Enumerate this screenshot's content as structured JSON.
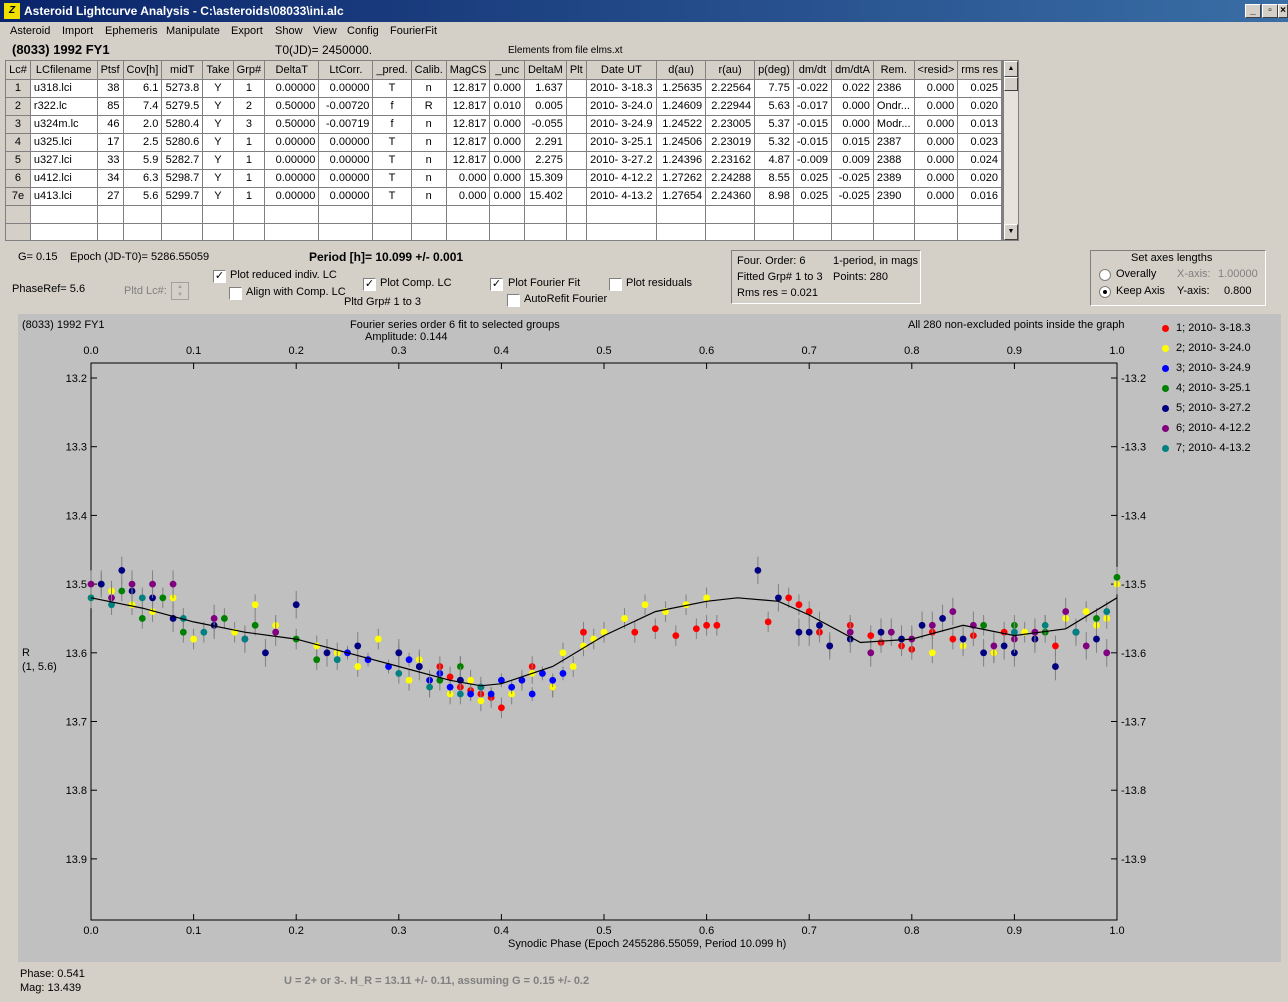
{
  "window": {
    "title": "Asteroid Lightcurve Analysis - C:\\asteroids\\08033\\ini.alc",
    "icon": "app-icon"
  },
  "menu": [
    "Asteroid",
    "Import",
    "Ephemeris",
    "Manipulate",
    "Export",
    "Show",
    "View",
    "Config",
    "FourierFit"
  ],
  "header": {
    "object": "(8033) 1992 FY1",
    "t0": "T0(JD)= 2450000.",
    "elements": "Elements from file elms.xt"
  },
  "grid": {
    "columns": [
      "Lc#",
      "LCfilename",
      "Ptsf",
      "Cov[h]",
      "midT",
      "Take",
      "Grp#",
      "DeltaT",
      "LtCorr.",
      "_pred.",
      "Calib.",
      "MagCS",
      "_unc",
      "DeltaM",
      "Plt",
      "Date UT",
      "d(au)",
      "r(au)",
      "p(deg)",
      "dm/dt",
      "dm/dtA",
      "Rem.",
      "<resid>",
      "rms res"
    ],
    "rows": [
      [
        "1",
        "u318.lci",
        "38",
        "6.1",
        "5273.8",
        "Y",
        "1",
        "0.00000",
        "0.00000",
        "T",
        "n",
        "12.817",
        "0.000",
        "1.637",
        "",
        "2010- 3-18.3",
        "1.25635",
        "2.22564",
        "7.75",
        "-0.022",
        "0.022",
        "2386",
        "0.000",
        "0.025"
      ],
      [
        "2",
        "r322.lc",
        "85",
        "7.4",
        "5279.5",
        "Y",
        "2",
        "0.50000",
        "-0.00720",
        "f",
        "R",
        "12.817",
        "0.010",
        "0.005",
        "",
        "2010- 3-24.0",
        "1.24609",
        "2.22944",
        "5.63",
        "-0.017",
        "0.000",
        "Ondr...",
        "0.000",
        "0.020"
      ],
      [
        "3",
        "u324m.lc",
        "46",
        "2.0",
        "5280.4",
        "Y",
        "3",
        "0.50000",
        "-0.00719",
        "f",
        "n",
        "12.817",
        "0.000",
        "-0.055",
        "",
        "2010- 3-24.9",
        "1.24522",
        "2.23005",
        "5.37",
        "-0.015",
        "0.000",
        "Modr...",
        "0.000",
        "0.013"
      ],
      [
        "4",
        "u325.lci",
        "17",
        "2.5",
        "5280.6",
        "Y",
        "1",
        "0.00000",
        "0.00000",
        "T",
        "n",
        "12.817",
        "0.000",
        "2.291",
        "",
        "2010- 3-25.1",
        "1.24506",
        "2.23019",
        "5.32",
        "-0.015",
        "0.015",
        "2387",
        "0.000",
        "0.023"
      ],
      [
        "5",
        "u327.lci",
        "33",
        "5.9",
        "5282.7",
        "Y",
        "1",
        "0.00000",
        "0.00000",
        "T",
        "n",
        "12.817",
        "0.000",
        "2.275",
        "",
        "2010- 3-27.2",
        "1.24396",
        "2.23162",
        "4.87",
        "-0.009",
        "0.009",
        "2388",
        "0.000",
        "0.024"
      ],
      [
        "6",
        "u412.lci",
        "34",
        "6.3",
        "5298.7",
        "Y",
        "1",
        "0.00000",
        "0.00000",
        "T",
        "n",
        "0.000",
        "0.000",
        "15.309",
        "",
        "2010- 4-12.2",
        "1.27262",
        "2.24288",
        "8.55",
        "0.025",
        "-0.025",
        "2389",
        "0.000",
        "0.020"
      ],
      [
        "7e",
        "u413.lci",
        "27",
        "5.6",
        "5299.7",
        "Y",
        "1",
        "0.00000",
        "0.00000",
        "T",
        "n",
        "0.000",
        "0.000",
        "15.402",
        "",
        "2010- 4-13.2",
        "1.27654",
        "2.24360",
        "8.98",
        "0.025",
        "-0.025",
        "2390",
        "0.000",
        "0.016"
      ]
    ]
  },
  "controls": {
    "g": "G= 0.15",
    "epoch": "Epoch (JD-T0)= 5286.55059",
    "period": "Period [h]= 10.099 +/- 0.001",
    "phaseref": "PhaseRef= 5.6",
    "pltd_lc": "Pltd Lc#:",
    "plot_reduced": "Plot reduced indiv. LC",
    "align_comp": "Align with Comp. LC",
    "plot_comp": "Plot Comp. LC",
    "pltd_grp": "Pltd Grp#  1   to   3",
    "plot_fourier": "Plot Fourier Fit",
    "autorefit": "AutoRefit Fourier",
    "plot_residuals": "Plot residuals",
    "four_order": "Four. Order:  6",
    "one_period": "1-period, in mags",
    "fitted_grp": "Fitted Grp# 1 to 3",
    "points": "Points: 280",
    "rms": "Rms res     = 0.021",
    "axes_title": "Set axes lengths",
    "overally": "Overally",
    "keep_axis": "Keep Axis",
    "xaxis_lbl": "X-axis:",
    "xaxis_val": "1.00000",
    "yaxis_lbl": "Y-axis:",
    "yaxis_val": "0.800"
  },
  "chart_texts": {
    "top_left": "(8033) 1992 FY1",
    "fit_title": "Fourier series order 6 fit to selected groups",
    "amplitude": "Amplitude: 0.144",
    "points_note": "All 280 non-excluded points inside the graph",
    "ylabel": "R",
    "ylabel2": "(1, 5.6)"
  },
  "chart_data": {
    "type": "scatter",
    "xlabel": "Synodic Phase (Epoch 2455286.55059, Period 10.099 h)",
    "ylabel": "R",
    "xlim": [
      0,
      1
    ],
    "ylim": [
      13.2,
      13.9
    ],
    "y_inverted": true,
    "xticks": [
      "0.0",
      "0.1",
      "0.2",
      "0.3",
      "0.4",
      "0.5",
      "0.6",
      "0.7",
      "0.8",
      "0.9",
      "1.0"
    ],
    "yticks": [
      "13.2",
      "13.3",
      "13.4",
      "13.5",
      "13.6",
      "13.7",
      "13.8",
      "13.9"
    ],
    "fourier_curve": {
      "x": [
        0,
        0.05,
        0.1,
        0.15,
        0.2,
        0.25,
        0.3,
        0.35,
        0.38,
        0.4,
        0.45,
        0.5,
        0.55,
        0.6,
        0.63,
        0.67,
        0.7,
        0.75,
        0.8,
        0.85,
        0.9,
        0.95,
        1.0
      ],
      "y": [
        13.52,
        13.535,
        13.555,
        13.57,
        13.58,
        13.6,
        13.62,
        13.64,
        13.648,
        13.645,
        13.62,
        13.575,
        13.54,
        13.525,
        13.52,
        13.525,
        13.545,
        13.585,
        13.58,
        13.56,
        13.575,
        13.565,
        13.52
      ]
    },
    "series": [
      {
        "name": "1; 2010- 3-18.3",
        "color": "#ff0000",
        "x": [
          0.33,
          0.34,
          0.35,
          0.36,
          0.37,
          0.38,
          0.39,
          0.4,
          0.43,
          0.45,
          0.48,
          0.53,
          0.55,
          0.57,
          0.59,
          0.6,
          0.61,
          0.66,
          0.68,
          0.69,
          0.7,
          0.71,
          0.72,
          0.74,
          0.76,
          0.77,
          0.79,
          0.8,
          0.82,
          0.84,
          0.86,
          0.88,
          0.89,
          0.92,
          0.94
        ],
        "y": [
          13.64,
          13.62,
          13.635,
          13.65,
          13.655,
          13.66,
          13.665,
          13.68,
          13.62,
          13.65,
          13.57,
          13.57,
          13.565,
          13.575,
          13.565,
          13.56,
          13.56,
          13.555,
          13.52,
          13.53,
          13.54,
          13.57,
          13.59,
          13.56,
          13.575,
          13.585,
          13.59,
          13.595,
          13.57,
          13.58,
          13.575,
          13.6,
          13.57,
          13.58,
          13.59
        ],
        "yerr": 0.015
      },
      {
        "name": "2; 2010- 3-24.0",
        "color": "#ffff00",
        "x": [
          0.0,
          0.02,
          0.04,
          0.06,
          0.08,
          0.1,
          0.12,
          0.14,
          0.16,
          0.18,
          0.22,
          0.24,
          0.26,
          0.28,
          0.3,
          0.31,
          0.32,
          0.33,
          0.34,
          0.35,
          0.36,
          0.37,
          0.38,
          0.41,
          0.42,
          0.43,
          0.45,
          0.46,
          0.47,
          0.48,
          0.49,
          0.5,
          0.52,
          0.54,
          0.56,
          0.58,
          0.6,
          0.8,
          0.82,
          0.85,
          0.88,
          0.9,
          0.91,
          0.93,
          0.95,
          0.97,
          0.98,
          0.99,
          1.0
        ],
        "y": [
          13.52,
          13.51,
          13.53,
          13.54,
          13.52,
          13.58,
          13.56,
          13.57,
          13.53,
          13.56,
          13.59,
          13.6,
          13.62,
          13.58,
          13.6,
          13.64,
          13.61,
          13.65,
          13.63,
          13.66,
          13.62,
          13.64,
          13.67,
          13.66,
          13.64,
          13.63,
          13.65,
          13.6,
          13.62,
          13.59,
          13.58,
          13.57,
          13.55,
          13.53,
          13.54,
          13.53,
          13.52,
          13.58,
          13.6,
          13.59,
          13.6,
          13.58,
          13.57,
          13.56,
          13.55,
          13.54,
          13.56,
          13.55,
          13.5
        ],
        "yerr": 0.015
      },
      {
        "name": "3; 2010- 3-24.9",
        "color": "#0000ff",
        "x": [
          0.25,
          0.27,
          0.29,
          0.3,
          0.31,
          0.32,
          0.33,
          0.34,
          0.35,
          0.36,
          0.37,
          0.38,
          0.39,
          0.4,
          0.41,
          0.42,
          0.43,
          0.44,
          0.45,
          0.46
        ],
        "y": [
          13.6,
          13.61,
          13.62,
          13.6,
          13.61,
          13.62,
          13.64,
          13.63,
          13.65,
          13.64,
          13.66,
          13.65,
          13.66,
          13.64,
          13.65,
          13.64,
          13.66,
          13.63,
          13.64,
          13.63
        ],
        "yerr": 0.01
      },
      {
        "name": "4; 2010- 3-25.1",
        "color": "#008000",
        "x": [
          0.01,
          0.03,
          0.05,
          0.07,
          0.09,
          0.13,
          0.16,
          0.2,
          0.22,
          0.34,
          0.36,
          0.87,
          0.9,
          0.93,
          0.96,
          0.98,
          1.0
        ],
        "y": [
          13.5,
          13.51,
          13.55,
          13.52,
          13.57,
          13.55,
          13.56,
          13.58,
          13.61,
          13.64,
          13.62,
          13.56,
          13.56,
          13.57,
          13.57,
          13.55,
          13.49
        ],
        "yerr": 0.015
      },
      {
        "name": "5; 2010- 3-27.2",
        "color": "#000080",
        "x": [
          0.01,
          0.03,
          0.04,
          0.06,
          0.08,
          0.12,
          0.17,
          0.2,
          0.23,
          0.26,
          0.3,
          0.32,
          0.36,
          0.65,
          0.67,
          0.69,
          0.7,
          0.71,
          0.72,
          0.74,
          0.77,
          0.79,
          0.81,
          0.83,
          0.85,
          0.87,
          0.89,
          0.9,
          0.92,
          0.94,
          0.96,
          0.98
        ],
        "y": [
          13.5,
          13.48,
          13.51,
          13.52,
          13.55,
          13.56,
          13.6,
          13.53,
          13.6,
          13.59,
          13.6,
          13.62,
          13.64,
          13.48,
          13.52,
          13.57,
          13.57,
          13.56,
          13.59,
          13.58,
          13.57,
          13.58,
          13.56,
          13.55,
          13.58,
          13.6,
          13.59,
          13.6,
          13.58,
          13.62,
          13.57,
          13.58
        ],
        "yerr": 0.02
      },
      {
        "name": "6; 2010- 4-12.2",
        "color": "#800080",
        "x": [
          0.0,
          0.02,
          0.04,
          0.06,
          0.08,
          0.12,
          0.15,
          0.18,
          0.74,
          0.76,
          0.78,
          0.8,
          0.82,
          0.84,
          0.86,
          0.88,
          0.9,
          0.92,
          0.95,
          0.97,
          0.99
        ],
        "y": [
          13.5,
          13.52,
          13.5,
          13.5,
          13.5,
          13.55,
          13.58,
          13.57,
          13.57,
          13.6,
          13.57,
          13.58,
          13.56,
          13.54,
          13.56,
          13.59,
          13.58,
          13.57,
          13.54,
          13.59,
          13.6
        ],
        "yerr": 0.02
      },
      {
        "name": "7; 2010- 4-13.2",
        "color": "#008080",
        "x": [
          0.0,
          0.02,
          0.05,
          0.09,
          0.11,
          0.15,
          0.24,
          0.3,
          0.33,
          0.36,
          0.38,
          0.9,
          0.93,
          0.96,
          0.99
        ],
        "y": [
          13.52,
          13.53,
          13.52,
          13.55,
          13.57,
          13.58,
          13.61,
          13.63,
          13.65,
          13.66,
          13.65,
          13.57,
          13.56,
          13.57,
          13.54
        ],
        "yerr": 0.015
      }
    ]
  },
  "status": {
    "phase": "Phase:  0.541",
    "mag": "Mag:    13.439",
    "note": "U = 2+ or 3-. H_R = 13.11 +/- 0.11, assuming G = 0.15 +/- 0.2"
  }
}
